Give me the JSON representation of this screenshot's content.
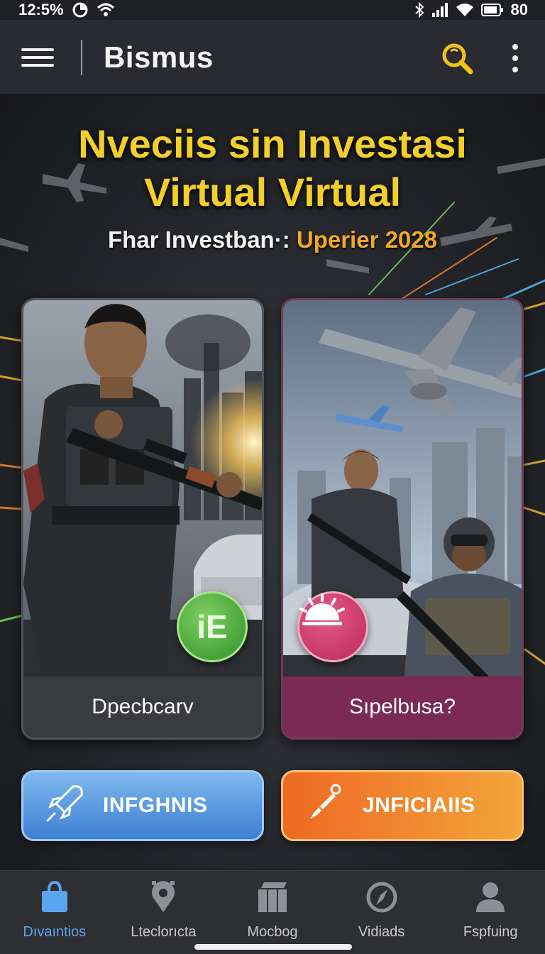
{
  "status_bar": {
    "time": "12:5%",
    "battery_text": "80",
    "icons": [
      "data-saver-icon",
      "wifi-call-icon",
      "bluetooth-icon",
      "signal-icon",
      "wifi-icon",
      "battery-icon"
    ]
  },
  "app_bar": {
    "title": "Bismus",
    "menu_icon": "hamburger-menu-icon",
    "search_icon": "search-icon",
    "more_icon": "more-vert-icon"
  },
  "hero": {
    "headline_line1": "Nveciis sin Investasi",
    "headline_line2": "Virtual Virtual",
    "subtitle_main": "Fhar Investban·:",
    "subtitle_accent": "Uperier 2028"
  },
  "cards": [
    {
      "label": "Dpecbcarv",
      "badge_text": "iE",
      "badge_color": "#3a9a34"
    },
    {
      "label": "Sıpelbusa?",
      "badge_icon": "sunrise-icon",
      "badge_color": "#c9306a"
    }
  ],
  "actions": [
    {
      "label": "INFGHNIS",
      "icon": "rocket-icon",
      "color": "#4a8be0"
    },
    {
      "label": "JNFICIAIIS",
      "icon": "pen-icon",
      "color": "#f08a2e"
    }
  ],
  "bottom_nav": {
    "items": [
      {
        "label": "Dıvaıntios",
        "icon": "shopping-bag-icon",
        "active": true
      },
      {
        "label": "Lteclorıcta",
        "icon": "location-pin-icon",
        "active": false
      },
      {
        "label": "Mocbog",
        "icon": "grid-icon",
        "active": false
      },
      {
        "label": "Vidiads",
        "icon": "compass-icon",
        "active": false
      },
      {
        "label": "Fspfuing",
        "icon": "person-icon",
        "active": false
      }
    ],
    "active_color": "#5aa4f0"
  },
  "colors": {
    "headline": "#f2cf2a",
    "accent_orange": "#f0a826",
    "search_icon": "#f2c21a"
  }
}
